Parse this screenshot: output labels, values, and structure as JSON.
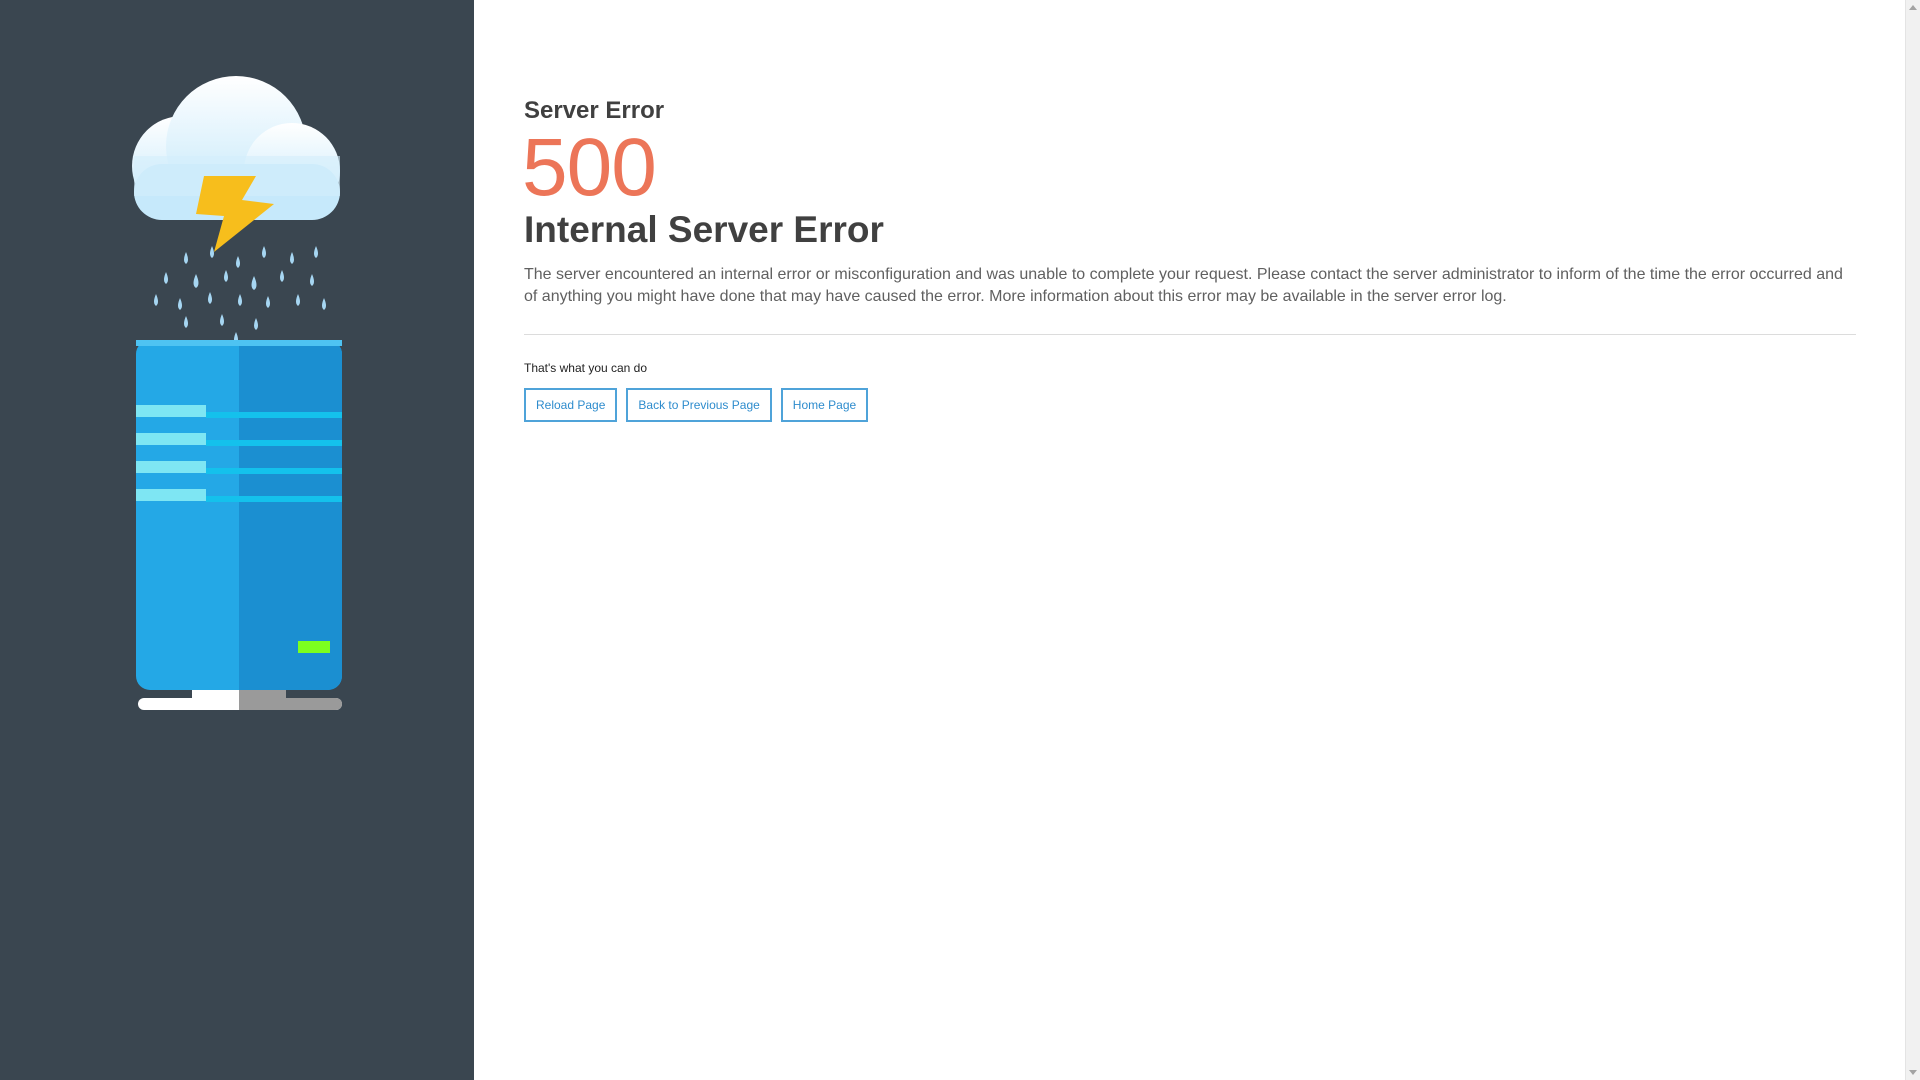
{
  "page": {
    "subtitle": "Server Error",
    "code": "500",
    "title": "Internal Server Error",
    "description": "The server encountered an internal error or misconfiguration and was unable to complete your request. Please contact the server administrator to inform of the time the error occurred and of anything you might have done that may have caused the error. More information about this error may be available in the server error log.",
    "actions_label": "That's what you can do",
    "buttons": [
      {
        "label": "Reload Page"
      },
      {
        "label": "Back to Previous Page"
      },
      {
        "label": "Home Page"
      }
    ]
  },
  "icons": {
    "illustration": "cloud-lightning-rain-server-icon"
  },
  "colors": {
    "sidebar": "#3a4650",
    "code": "#ec7558",
    "button_border": "#4fa3d9",
    "button_text": "#2e8ccd",
    "server_light": "#24a8e6",
    "server_dark": "#1b8fd1",
    "bolt": "#f7be1c",
    "status_led": "#7cff1e"
  }
}
